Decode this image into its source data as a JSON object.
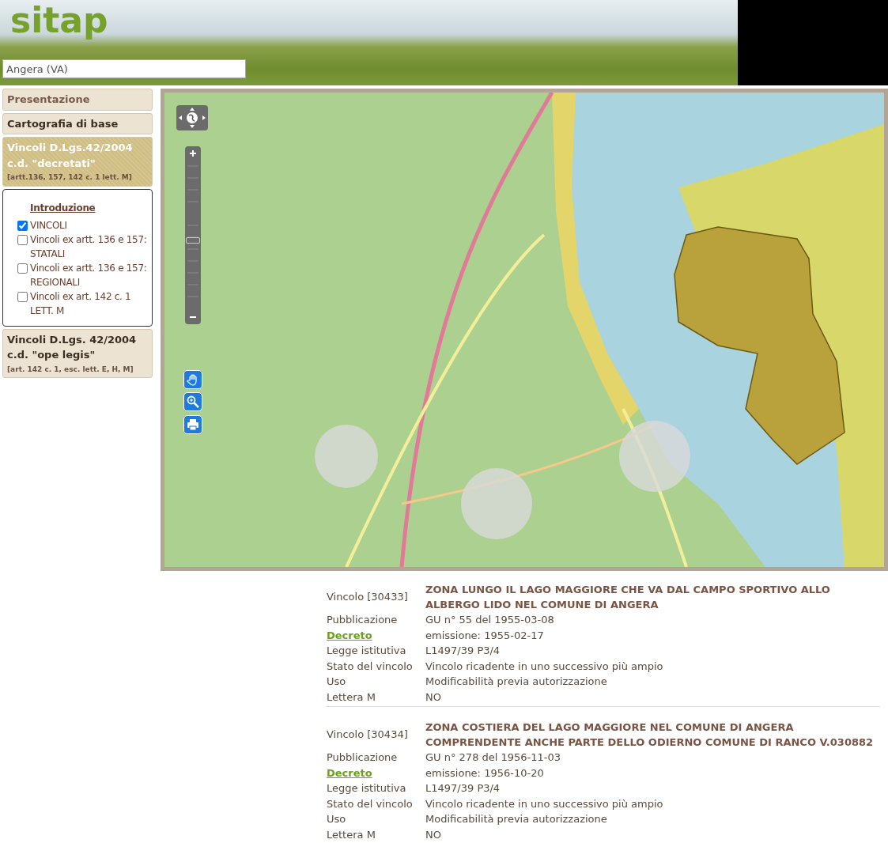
{
  "header": {
    "logo": "sitap",
    "search": {
      "value": "Angera (VA)"
    }
  },
  "sidebar": {
    "sections": [
      {
        "title": "Presentazione",
        "selected": false,
        "visited": true
      },
      {
        "title": "Cartografia di base",
        "selected": false,
        "visited": false
      },
      {
        "title": "Vincoli D.Lgs.42/2004 c.d. \"decretati\"",
        "subtitle": "[artt.136, 157, 142 c. 1 lett. M]",
        "selected": true,
        "visited": false,
        "panel": {
          "link": "Introduzione",
          "layers": [
            {
              "label": "VINCOLI",
              "checked": true
            },
            {
              "label": "Vincoli ex artt. 136 e 157: STATALI",
              "checked": false
            },
            {
              "label": "Vincoli ex artt. 136 e 157: REGIONALI",
              "checked": false
            },
            {
              "label": "Vincoli ex art. 142 c. 1 LETT. M",
              "checked": false
            }
          ]
        }
      },
      {
        "title": "Vincoli D.Lgs. 42/2004 c.d. \"ope legis\"",
        "subtitle": "[art. 142 c. 1, esc. lett. E, H, M]",
        "selected": false,
        "visited": false
      }
    ]
  },
  "map": {
    "zoom_slider": {
      "level": 0.47
    }
  },
  "records": [
    {
      "rows": [
        {
          "kind": "title",
          "label": "Vincolo [30433]",
          "value": "ZONA LUNGO IL LAGO MAGGIORE CHE VA DAL CAMPO SPORTIVO ALLO ALBERGO LIDO NEL COMUNE DI ANGERA"
        },
        {
          "kind": "text",
          "label": "Pubblicazione",
          "value": "GU n° 55 del 1955-03-08"
        },
        {
          "kind": "link",
          "label": "Decreto",
          "value": "emissione: 1955-02-17"
        },
        {
          "kind": "text",
          "label": "Legge istitutiva",
          "value": "L1497/39 P3/4"
        },
        {
          "kind": "text",
          "label": "Stato del vincolo",
          "value": "Vincolo ricadente in uno successivo più ampio"
        },
        {
          "kind": "text",
          "label": "Uso",
          "value": "Modificabilità previa autorizzazione"
        },
        {
          "kind": "text",
          "label": "Lettera M",
          "value": "NO"
        }
      ]
    },
    {
      "rows": [
        {
          "kind": "title",
          "label": "Vincolo [30434]",
          "value": "ZONA COSTIERA DEL LAGO MAGGIORE NEL COMUNE DI ANGERA COMPRENDENTE ANCHE PARTE DELLO ODIERNO COMUNE DI RANCO V.030882"
        },
        {
          "kind": "text",
          "label": "Pubblicazione",
          "value": "GU n° 278 del 1956-11-03"
        },
        {
          "kind": "link",
          "label": "Decreto",
          "value": "emissione: 1956-10-20"
        },
        {
          "kind": "text",
          "label": "Legge istitutiva",
          "value": "L1497/39 P3/4"
        },
        {
          "kind": "text",
          "label": "Stato del vincolo",
          "value": "Vincolo ricadente in uno successivo più ampio"
        },
        {
          "kind": "text",
          "label": "Uso",
          "value": "Modificabilità previa autorizzazione"
        },
        {
          "kind": "text",
          "label": "Lettera M",
          "value": "NO"
        }
      ]
    }
  ]
}
